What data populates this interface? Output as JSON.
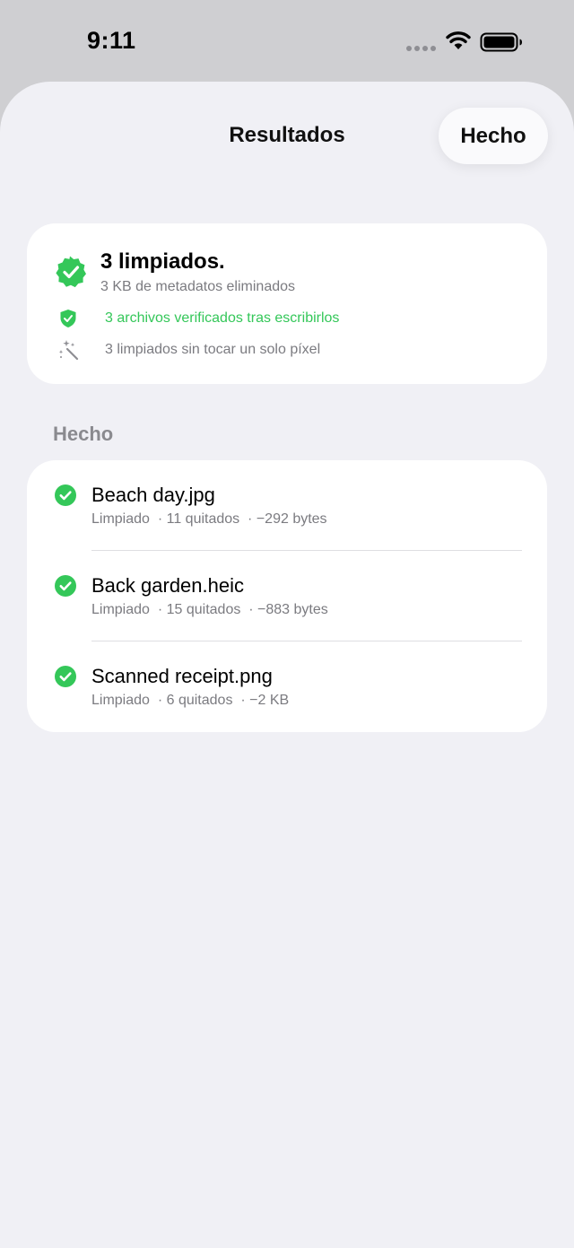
{
  "status_bar": {
    "time": "9:11"
  },
  "nav": {
    "title": "Resultados",
    "done_label": "Hecho"
  },
  "summary": {
    "title": "3 limpiados.",
    "subtitle": "3 KB de metadatos eliminados",
    "verified": "3 archivos verificados tras escribirlos",
    "pixel_note": "3 limpiados sin tocar un solo píxel"
  },
  "section": {
    "header": "Hecho"
  },
  "files": [
    {
      "name": "Beach day.jpg",
      "status": "Limpiado",
      "removed": "11 quitados",
      "saved": "−292 bytes"
    },
    {
      "name": "Back garden.heic",
      "status": "Limpiado",
      "removed": "15 quitados",
      "saved": "−883 bytes"
    },
    {
      "name": "Scanned receipt.png",
      "status": "Limpiado",
      "removed": "6 quitados",
      "saved": "−2 KB"
    }
  ],
  "colors": {
    "accent_green": "#34c759",
    "sheet_background": "#f0f0f5",
    "secondary_text": "#7b7b80"
  },
  "icons": {
    "badge": "checkmark-seal-icon",
    "shield": "checkmark-shield-icon",
    "wand": "magic-wand-icon",
    "row_check": "checkmark-circle-icon"
  }
}
